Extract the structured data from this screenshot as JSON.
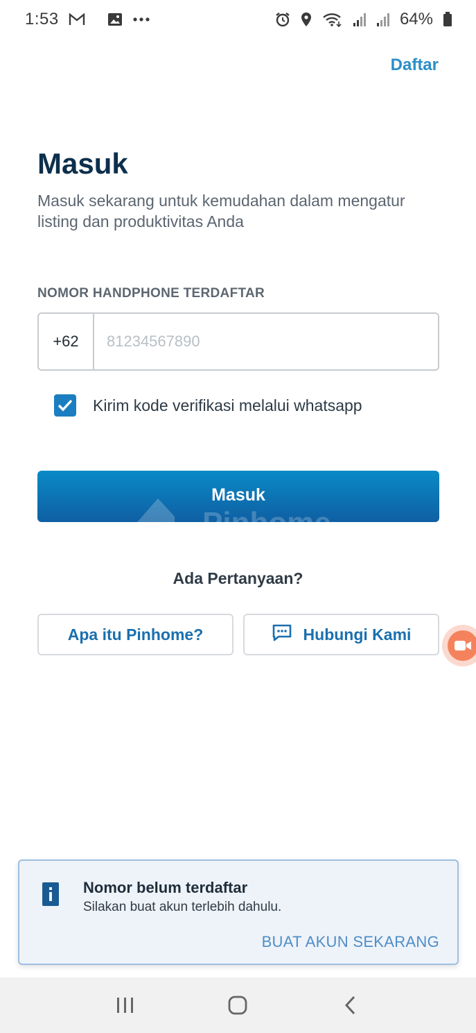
{
  "status_bar": {
    "time": "1:53",
    "battery": "64%",
    "icons": [
      "gmail-icon",
      "image-icon",
      "more-dots-icon",
      "alarm-icon",
      "location-icon",
      "wifi-icon",
      "signal-icon",
      "signal-icon",
      "battery-icon"
    ]
  },
  "header": {
    "register_link": "Daftar"
  },
  "page": {
    "title": "Masuk",
    "subtitle": "Masuk sekarang untuk kemudahan dalam mengatur listing dan produktivitas Anda"
  },
  "form": {
    "phone_label": "NOMOR HANDPHONE TERDAFTAR",
    "country_code": "+62",
    "phone_placeholder": "81234567890",
    "phone_value": "",
    "whatsapp_checkbox": {
      "label": "Kirim kode verifikasi melalui whatsapp",
      "checked": true
    },
    "submit_label": "Masuk",
    "watermark": "Pinhome"
  },
  "help": {
    "question": "Ada Pertanyaan?",
    "about_button": "Apa itu Pinhome?",
    "contact_button": "Hubungi Kami"
  },
  "snackbar": {
    "title": "Nomor belum terdaftar",
    "message": "Silakan buat akun terlebih dahulu.",
    "action": "BUAT AKUN SEKARANG"
  },
  "colors": {
    "primary": "#1b7ec0",
    "title": "#0c2f4c",
    "link": "#2a8fc7",
    "snackbar_bg": "#eef3f9"
  }
}
